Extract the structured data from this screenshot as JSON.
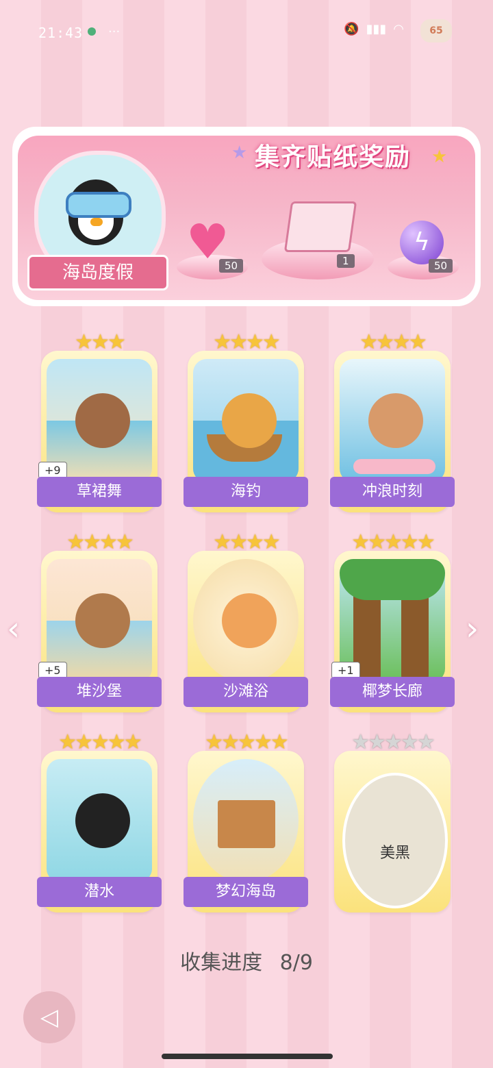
{
  "status_bar": {
    "time": "21:43",
    "dots": "···",
    "battery": "65"
  },
  "banner": {
    "title": "集齐贴纸奖励",
    "medal_label": "海岛度假"
  },
  "rewards": [
    {
      "name": "heart-gem",
      "count": "50"
    },
    {
      "name": "gift-box",
      "count": "1"
    },
    {
      "name": "energy-orb",
      "count": "50"
    }
  ],
  "cards": [
    {
      "label": "草裙舞",
      "stars": "★★★",
      "plus": "+9",
      "locked": false
    },
    {
      "label": "海钓",
      "stars": "★★★★",
      "plus": "",
      "locked": false
    },
    {
      "label": "冲浪时刻",
      "stars": "★★★★",
      "plus": "",
      "locked": false
    },
    {
      "label": "堆沙堡",
      "stars": "★★★★",
      "plus": "+5",
      "locked": false
    },
    {
      "label": "沙滩浴",
      "stars": "★★★★",
      "plus": "",
      "locked": false
    },
    {
      "label": "椰梦长廊",
      "stars": "★★★★★",
      "plus": "+1",
      "locked": false
    },
    {
      "label": "潜水",
      "stars": "★★★★★",
      "plus": "",
      "locked": false
    },
    {
      "label": "梦幻海岛",
      "stars": "★★★★★",
      "plus": "",
      "locked": false
    },
    {
      "label": "美黑",
      "stars": "★★★★★",
      "plus": "",
      "locked": true
    }
  ],
  "progress": {
    "label": "收集进度",
    "value": "8/9"
  },
  "colors": {
    "accent_purple": "#9b6bd7",
    "banner_pink": "#f8a6bf",
    "star_gold": "#f7c43a",
    "background": "#fbd9e2"
  }
}
